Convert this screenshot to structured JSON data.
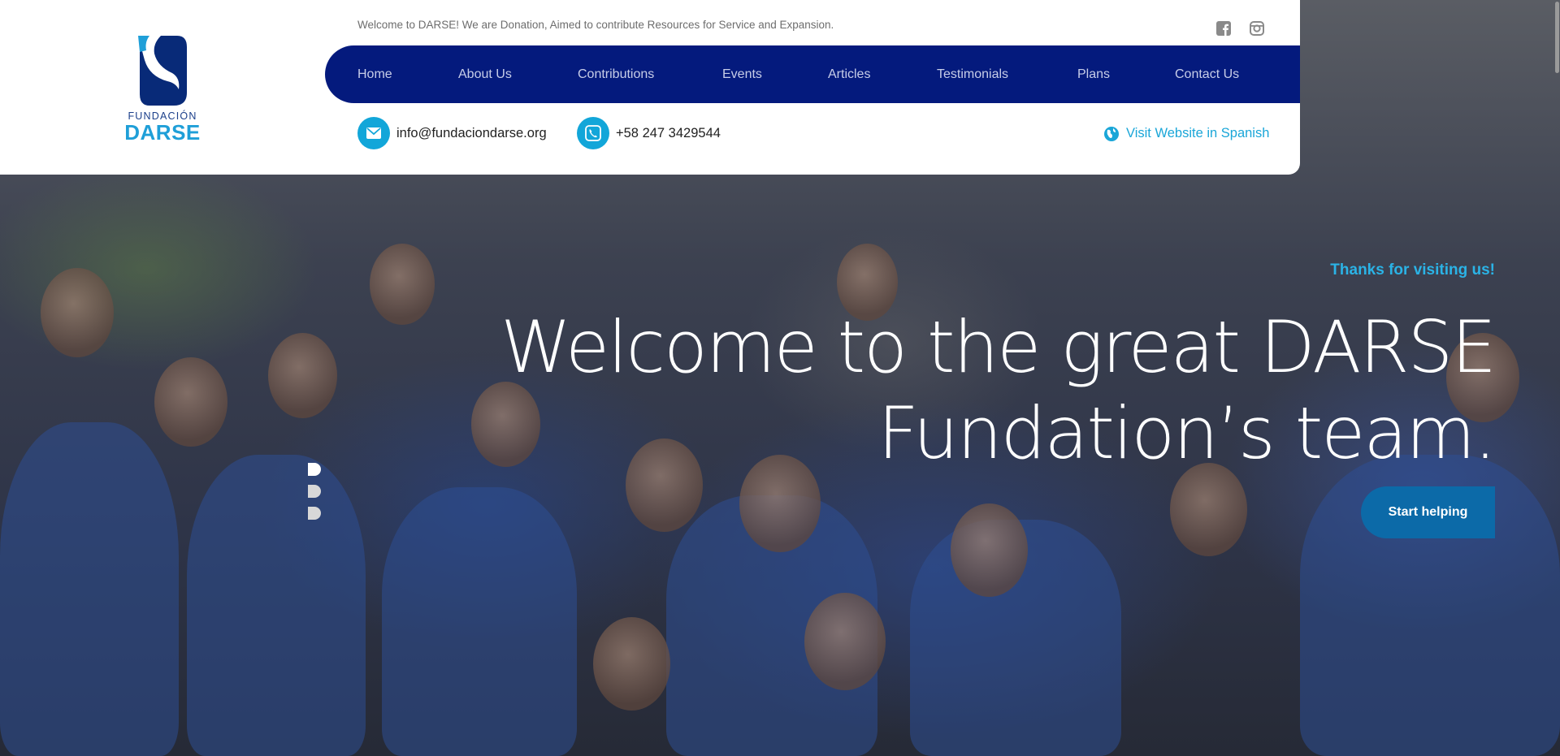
{
  "topbar": {
    "welcome_text": "Welcome to DARSE! We are Donation, Aimed to contribute Resources for Service and Expansion.",
    "social": [
      {
        "icon": "facebook-icon"
      },
      {
        "icon": "instagram-icon"
      }
    ]
  },
  "logo": {
    "line1": "FUNDACIÓN",
    "line2": "DARSE"
  },
  "nav": {
    "items": [
      {
        "label": "Home"
      },
      {
        "label": "About Us"
      },
      {
        "label": "Contributions"
      },
      {
        "label": "Events"
      },
      {
        "label": "Articles"
      },
      {
        "label": "Testimonials"
      },
      {
        "label": "Plans"
      },
      {
        "label": "Contact Us"
      }
    ]
  },
  "contact": {
    "email": "info@fundaciondarse.org",
    "phone": "+58 247 3429544",
    "language_link": "Visit Website in Spanish"
  },
  "hero": {
    "subtitle": "Thanks for visiting us!",
    "title_line1": "Welcome to the great DARSE",
    "title_line2": "Fundation’s team.",
    "cta_label": "Start helping",
    "slides": 3,
    "active_slide": 1
  },
  "colors": {
    "nav_bg": "#041a7d",
    "accent": "#12a6d9",
    "cta_bg": "#0c6aa8"
  }
}
